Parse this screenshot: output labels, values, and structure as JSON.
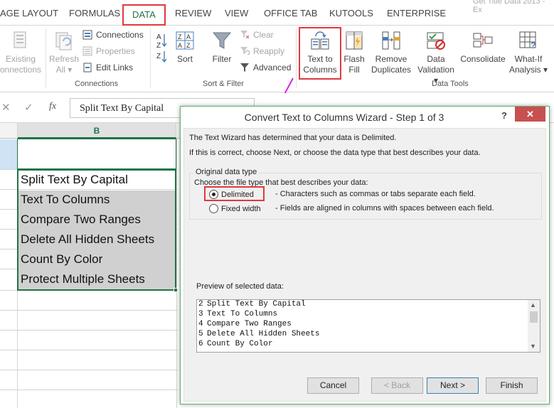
{
  "title_fragment": "Get Title Data 2013 - Ex",
  "ribbon_tabs": [
    {
      "label": "AGE LAYOUT",
      "active": false
    },
    {
      "label": "FORMULAS",
      "active": false
    },
    {
      "label": "DATA",
      "active": true
    },
    {
      "label": "REVIEW",
      "active": false
    },
    {
      "label": "VIEW",
      "active": false
    },
    {
      "label": "OFFICE TAB",
      "active": false
    },
    {
      "label": "KUTOOLS",
      "active": false
    },
    {
      "label": "ENTERPRISE",
      "active": false
    }
  ],
  "ribbon": {
    "get_external": {
      "line1": "Existing",
      "line2": "onnections"
    },
    "refresh_all": {
      "line1": "Refresh",
      "line2": "All ▾"
    },
    "connections": {
      "label": "Connections"
    },
    "properties": {
      "label": "Properties"
    },
    "edit_links": {
      "label": "Edit Links"
    },
    "connections_group": "Connections",
    "sort_az": {
      "top": "A",
      "bottom": "Z"
    },
    "sort": {
      "label": "Sort"
    },
    "filter": {
      "label": "Filter"
    },
    "clear": {
      "label": "Clear"
    },
    "reapply": {
      "label": "Reapply"
    },
    "advanced": {
      "label": "Advanced"
    },
    "sort_filter_group": "Sort & Filter",
    "text_to_columns": {
      "line1": "Text to",
      "line2": "Columns"
    },
    "flash_fill": {
      "line1": "Flash",
      "line2": "Fill"
    },
    "remove_duplicates": {
      "line1": "Remove",
      "line2": "Duplicates"
    },
    "data_validation": {
      "line1": "Data",
      "line2": "Validation ▾"
    },
    "consolidate": {
      "line1": "Consolidate"
    },
    "what_if": {
      "line1": "What-If",
      "line2": "Analysis ▾"
    },
    "data_tools_group": "Data Tools"
  },
  "formula_bar": {
    "cancel": "✕",
    "enter": "✓",
    "fx": "fx",
    "content": "Split Text By Capital"
  },
  "sheet": {
    "column_header": "B",
    "cells": [
      "Split Text By Capital",
      "Text To Columns",
      "Compare Two Ranges",
      "Delete All Hidden Sheets",
      "Count By Color",
      "Protect Multiple Sheets"
    ]
  },
  "dialog": {
    "title": "Convert Text to Columns Wizard - Step 1 of 3",
    "help": "?",
    "close": "✕",
    "line1": "The Text Wizard has determined that your data is Delimited.",
    "line2": "If this is correct, choose Next, or choose the data type that best describes your data.",
    "group_label": "Original data type",
    "choose_label": "Choose the file type that best describes your data:",
    "options": [
      {
        "label": "Delimited",
        "desc": "- Characters such as commas or tabs separate each field.",
        "selected": true
      },
      {
        "label": "Fixed width",
        "desc": "- Fields are aligned in columns with spaces between each field.",
        "selected": false
      }
    ],
    "preview_label": "Preview of selected data:",
    "preview_lines": [
      {
        "num": "2",
        "text": "Split Text By Capital"
      },
      {
        "num": "3",
        "text": "Text To Columns"
      },
      {
        "num": "4",
        "text": "Compare Two Ranges"
      },
      {
        "num": "5",
        "text": "Delete All Hidden Sheets"
      },
      {
        "num": "6",
        "text": "Count By Color"
      }
    ],
    "buttons": {
      "cancel": "Cancel",
      "back": "< Back",
      "next": "Next >",
      "finish": "Finish"
    }
  },
  "colors": {
    "excel_green": "#217346",
    "highlight_red": "#e0393e",
    "arrow_magenta": "#e020e0",
    "close_red": "#c75050"
  }
}
